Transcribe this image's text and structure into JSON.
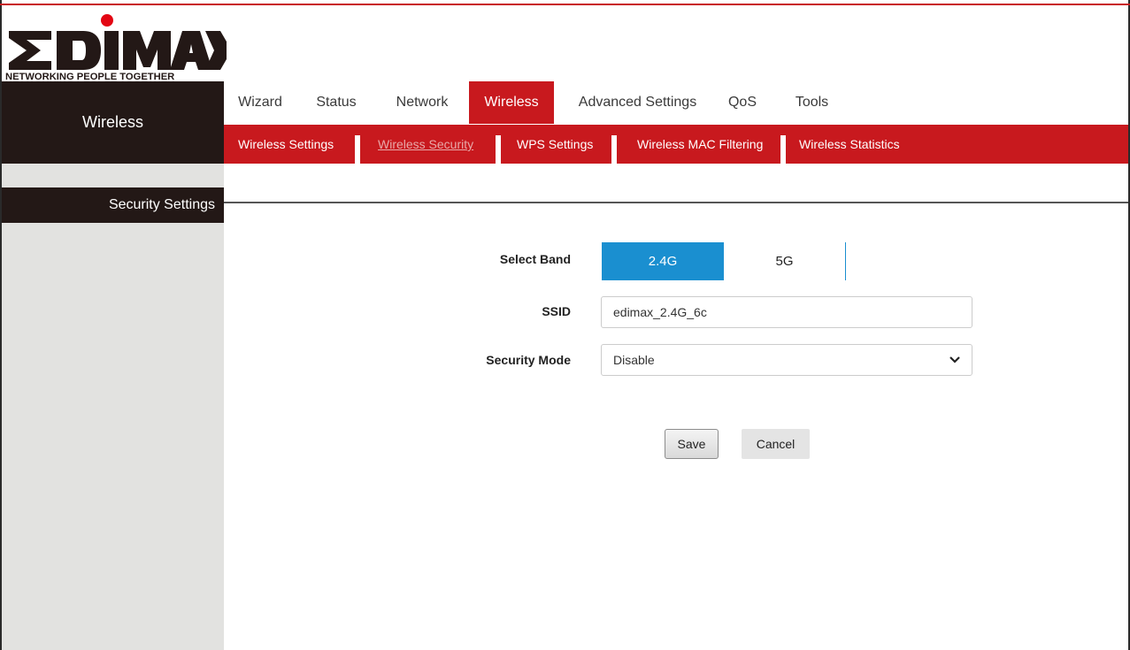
{
  "logo": {
    "brand": "EDIMAX",
    "tagline": "NETWORKING PEOPLE TOGETHER",
    "accent_color": "#e30613"
  },
  "section_title": "Wireless",
  "main_nav": [
    "Wizard",
    "Status",
    "Network",
    "Wireless",
    "Advanced Settings",
    "QoS",
    "Tools"
  ],
  "main_nav_active": "Wireless",
  "sub_nav": [
    "Wireless Settings",
    "Wireless Security",
    "WPS Settings",
    "Wireless MAC Filtering",
    "Wireless Statistics"
  ],
  "sub_nav_active": "Wireless Security",
  "sidebar": {
    "items": [
      "Security Settings"
    ]
  },
  "form": {
    "band_label": "Select Band",
    "band_options": [
      "2.4G",
      "5G"
    ],
    "band_selected": "2.4G",
    "ssid_label": "SSID",
    "ssid_value": "edimax_2.4G_6c",
    "security_mode_label": "Security Mode",
    "security_mode_value": "Disable",
    "save_label": "Save",
    "cancel_label": "Cancel"
  },
  "colors": {
    "brand_red": "#c8191e",
    "dark": "#231816",
    "band_active": "#1a8fd0",
    "sidebar_bg": "#e2e2e0"
  }
}
